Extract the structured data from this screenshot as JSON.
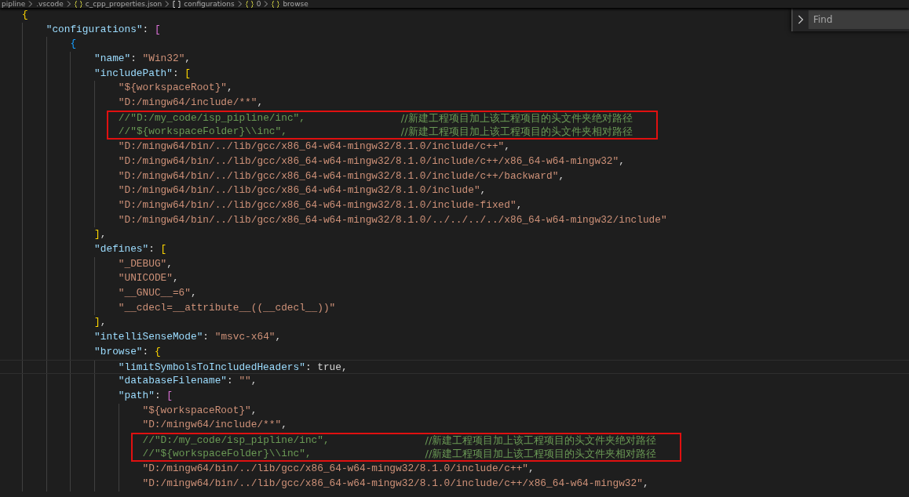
{
  "breadcrumbs": [
    {
      "kind": "folder",
      "label": "pipline"
    },
    {
      "kind": "folder",
      "label": ".vscode"
    },
    {
      "kind": "object",
      "label": "c_cpp_properties.json"
    },
    {
      "kind": "array",
      "label": "configurations"
    },
    {
      "kind": "object",
      "label": "0"
    },
    {
      "kind": "object",
      "label": "browse"
    }
  ],
  "find_widget": {
    "placeholder": "Find"
  },
  "code": [
    {
      "kind": "line",
      "text": "{",
      "current": false,
      "children": [
        {
          "kind": "line",
          "text": "\"configurations\": [",
          "current": false,
          "children": [
            {
              "kind": "line",
              "text": "{",
              "current": false,
              "children": [
                {
                  "kind": "line",
                  "text": "\"name\": \"Win32\",",
                  "current": false
                },
                {
                  "kind": "line",
                  "text": "\"includePath\": [",
                  "current": false,
                  "children": [
                    {
                      "kind": "line",
                      "text": "\"${workspaceRoot}\",",
                      "current": false
                    },
                    {
                      "kind": "line",
                      "text": "\"D:/mingw64/include/**\",",
                      "current": false
                    },
                    {
                      "kind": "annotation",
                      "lines": [
                        {
                          "text": "//\"D:/my_code/isp_pipline/inc\",",
                          "note": "//新建工程项目加上该工程项目的头文件夹绝对路径"
                        },
                        {
                          "text": "//\"${workspaceFolder}\\\\inc\",",
                          "note": "//新建工程项目加上该工程项目的头文件夹相对路径"
                        }
                      ]
                    },
                    {
                      "kind": "line",
                      "text": "\"D:/mingw64/bin/../lib/gcc/x86_64-w64-mingw32/8.1.0/include/c++\",",
                      "current": false
                    },
                    {
                      "kind": "line",
                      "text": "\"D:/mingw64/bin/../lib/gcc/x86_64-w64-mingw32/8.1.0/include/c++/x86_64-w64-mingw32\",",
                      "current": false
                    },
                    {
                      "kind": "line",
                      "text": "\"D:/mingw64/bin/../lib/gcc/x86_64-w64-mingw32/8.1.0/include/c++/backward\",",
                      "current": false
                    },
                    {
                      "kind": "line",
                      "text": "\"D:/mingw64/bin/../lib/gcc/x86_64-w64-mingw32/8.1.0/include\",",
                      "current": false
                    },
                    {
                      "kind": "line",
                      "text": "\"D:/mingw64/bin/../lib/gcc/x86_64-w64-mingw32/8.1.0/include-fixed\",",
                      "current": false
                    },
                    {
                      "kind": "line",
                      "text": "\"D:/mingw64/bin/../lib/gcc/x86_64-w64-mingw32/8.1.0/../../../../x86_64-w64-mingw32/include\"",
                      "current": false
                    }
                  ]
                },
                {
                  "kind": "line",
                  "text": "],",
                  "current": false
                },
                {
                  "kind": "line",
                  "text": "\"defines\": [",
                  "current": false,
                  "children": [
                    {
                      "kind": "line",
                      "text": "\"_DEBUG\",",
                      "current": false
                    },
                    {
                      "kind": "line",
                      "text": "\"UNICODE\",",
                      "current": false
                    },
                    {
                      "kind": "line",
                      "text": "\"__GNUC__=6\",",
                      "current": false
                    },
                    {
                      "kind": "line",
                      "text": "\"__cdecl=__attribute__((__cdecl__))\"",
                      "current": false
                    }
                  ]
                },
                {
                  "kind": "line",
                  "text": "],",
                  "current": false
                },
                {
                  "kind": "line",
                  "text": "\"intelliSenseMode\": \"msvc-x64\",",
                  "current": false
                },
                {
                  "kind": "line",
                  "text": "\"browse\": {",
                  "current": false,
                  "children": [
                    {
                      "kind": "line",
                      "text": "\"limitSymbolsToIncludedHeaders\": true,",
                      "current": true
                    },
                    {
                      "kind": "line",
                      "text": "\"databaseFilename\": \"\",",
                      "current": false
                    },
                    {
                      "kind": "line",
                      "text": "\"path\": [",
                      "current": false,
                      "children": [
                        {
                          "kind": "line",
                          "text": "\"${workspaceRoot}\",",
                          "current": false
                        },
                        {
                          "kind": "line",
                          "text": "\"D:/mingw64/include/**\",",
                          "current": false
                        },
                        {
                          "kind": "annotation",
                          "lines": [
                            {
                              "text": "//\"D:/my_code/isp_pipline/inc\",",
                              "note": "//新建工程项目加上该工程项目的头文件夹绝对路径"
                            },
                            {
                              "text": "//\"${workspaceFolder}\\\\inc\",",
                              "note": "//新建工程项目加上该工程项目的头文件夹相对路径"
                            }
                          ]
                        },
                        {
                          "kind": "line",
                          "text": "\"D:/mingw64/bin/../lib/gcc/x86_64-w64-mingw32/8.1.0/include/c++\",",
                          "current": false
                        },
                        {
                          "kind": "line",
                          "text": "\"D:/mingw64/bin/../lib/gcc/x86_64-w64-mingw32/8.1.0/include/c++/x86_64-w64-mingw32\",",
                          "current": false
                        }
                      ]
                    }
                  ]
                }
              ]
            }
          ]
        }
      ]
    }
  ]
}
